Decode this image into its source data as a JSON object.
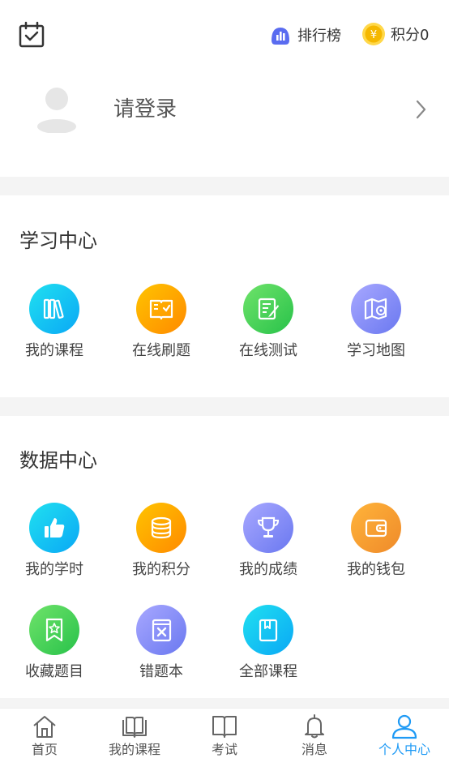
{
  "header": {
    "rank_label": "排行榜",
    "points_label": "积分0"
  },
  "profile": {
    "login_label": "请登录"
  },
  "study_center": {
    "title": "学习中心",
    "items": [
      {
        "label": "我的课程",
        "icon": "books-icon",
        "color": "#0aa8f5"
      },
      {
        "label": "在线刷题",
        "icon": "open-book-check-icon",
        "color": "#ff8a00"
      },
      {
        "label": "在线测试",
        "icon": "edit-document-icon",
        "color": "#28c24a"
      },
      {
        "label": "学习地图",
        "icon": "map-pin-icon",
        "color": "#6a78f0"
      }
    ]
  },
  "data_center": {
    "title": "数据中心",
    "items": [
      {
        "label": "我的学时",
        "icon": "thumbs-up-icon",
        "color": "#0aa8f5"
      },
      {
        "label": "我的积分",
        "icon": "coin-stack-icon",
        "color": "#ff8a00"
      },
      {
        "label": "我的成绩",
        "icon": "trophy-icon",
        "color": "#6a78f0"
      },
      {
        "label": "我的钱包",
        "icon": "wallet-icon",
        "color": "#ef8a2a"
      },
      {
        "label": "收藏题目",
        "icon": "bookmark-star-icon",
        "color": "#28c24a"
      },
      {
        "label": "错题本",
        "icon": "wrong-book-icon",
        "color": "#6a78f0"
      },
      {
        "label": "全部课程",
        "icon": "book-bookmark-icon",
        "color": "#0aa8f5"
      }
    ]
  },
  "tabbar": {
    "items": [
      {
        "label": "首页",
        "icon": "home-icon"
      },
      {
        "label": "我的课程",
        "icon": "open-book-icon"
      },
      {
        "label": "考试",
        "icon": "book-icon"
      },
      {
        "label": "消息",
        "icon": "bell-icon"
      },
      {
        "label": "个人中心",
        "icon": "user-icon",
        "active": true
      }
    ],
    "active_color": "#1e9af5"
  }
}
